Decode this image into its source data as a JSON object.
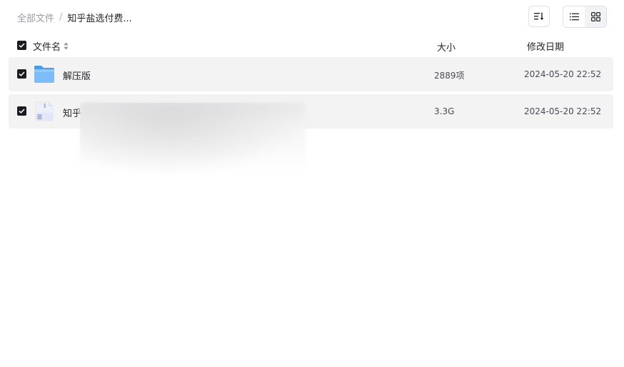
{
  "breadcrumb": {
    "root": "全部文件",
    "separator": "/",
    "current": "知乎盐选付费..."
  },
  "toolbar": {
    "sort_icon": "sort-list-icon",
    "view_list_icon": "list-view-icon",
    "view_grid_icon": "grid-view-icon"
  },
  "table": {
    "headers": {
      "name": "文件名",
      "size": "大小",
      "date": "修改日期"
    },
    "rows": [
      {
        "name": "解压版",
        "type": "folder",
        "size": "2889项",
        "date": "2024-05-20 22:52",
        "checked": true
      },
      {
        "name": "知乎",
        "type": "archive",
        "size": "3.3G",
        "date": "2024-05-20 22:52",
        "checked": true
      }
    ]
  },
  "colors": {
    "row_bg": "#f3f3f4",
    "checkbox": "#1b1c21",
    "folder": "#6fb3f7"
  }
}
